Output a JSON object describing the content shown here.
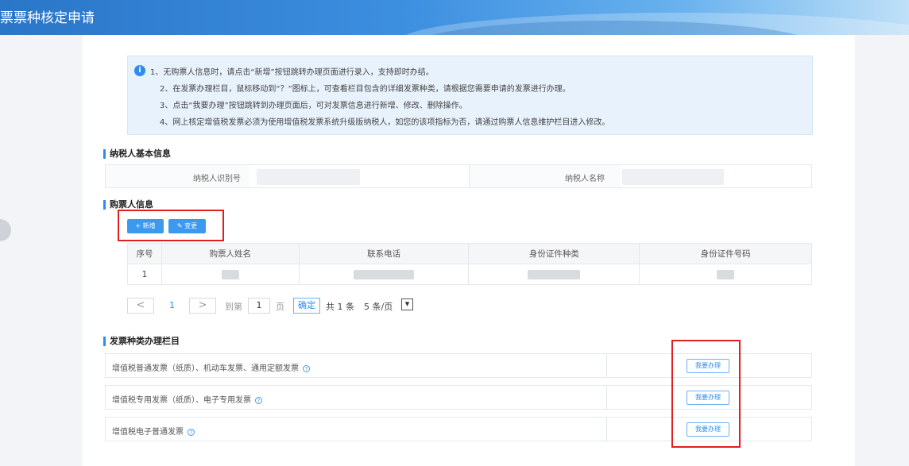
{
  "header": {
    "title": "票票种核定申请"
  },
  "notice": {
    "lines": [
      "1、无购票人信息时，请点击“新增”按钮跳转办理页面进行录入，支持即时办结。",
      "2、在发票办理栏目，鼠标移动到“？”图标上，可查看栏目包含的详细发票种类，请根据您需要申请的发票进行办理。",
      "3、点击“我要办理”按钮跳转到办理页面后，可对发票信息进行新增、修改、删除操作。",
      "4、网上核定增值税发票必须为使用增值税发票系统升级版纳税人，如您的该项指标为否，请通过购票人信息维护栏目进入修改。"
    ]
  },
  "taxpayer": {
    "section_title": "纳税人基本信息",
    "id_label": "纳税人识别号",
    "name_label": "纳税人名称"
  },
  "buyers": {
    "section_title": "购票人信息",
    "add_button": "+ 新增",
    "change_button": "✎ 变更",
    "columns": [
      "序号",
      "购票人姓名",
      "联系电话",
      "身份证件种类",
      "身份证件号码"
    ],
    "rows": [
      {
        "index": "1"
      }
    ]
  },
  "pager": {
    "prev": "<",
    "current": "1",
    "next": ">",
    "goto_label": "到第",
    "page_input": "1",
    "page_unit": "页",
    "confirm": "确定",
    "total": "共 1 条",
    "page_size": "5 条/页",
    "dropdown_arrow": "▾"
  },
  "invoice_types": {
    "section_title": "发票种类办理栏目",
    "items": [
      {
        "name": "增值税普通发票（纸质）、机动车发票、通用定额发票",
        "button": "我要办理"
      },
      {
        "name": "增值税专用发票（纸质）、电子专用发票",
        "button": "我要办理"
      },
      {
        "name": "增值税电子普通发票",
        "button": "我要办理"
      }
    ],
    "help_glyph": "?"
  },
  "colors": {
    "accent": "#2d8cf0",
    "highlight_box": "#e02020"
  }
}
